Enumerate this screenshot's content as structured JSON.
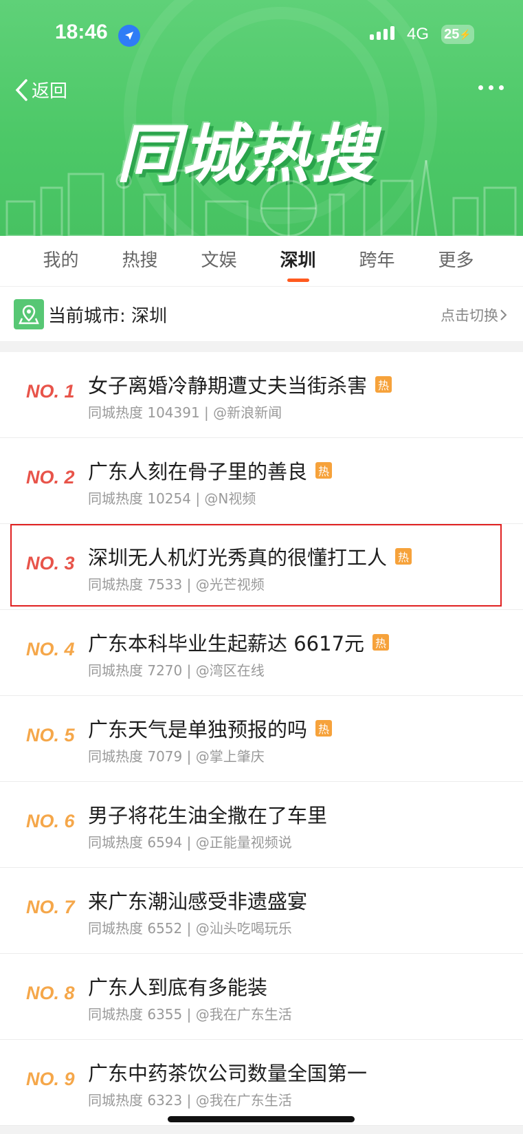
{
  "status_bar": {
    "time": "18:46",
    "network": "4G",
    "battery": "25"
  },
  "header": {
    "back_label": "返回",
    "banner_title": "同城热搜"
  },
  "tabs": [
    {
      "label": "我的"
    },
    {
      "label": "热搜"
    },
    {
      "label": "文娱"
    },
    {
      "label": "深圳",
      "active": true
    },
    {
      "label": "跨年"
    },
    {
      "label": "更多"
    }
  ],
  "city": {
    "label": "当前城市: 深圳",
    "switch_label": "点击切换"
  },
  "hot_badge": "热",
  "items": [
    {
      "rank": "NO. 1",
      "title": "女子离婚冷静期遭丈夫当街杀害",
      "hot": true,
      "meta": "同城热度 104391 | @新浪新闻"
    },
    {
      "rank": "NO. 2",
      "title": "广东人刻在骨子里的善良",
      "hot": true,
      "meta": "同城热度 10254 | @N视频"
    },
    {
      "rank": "NO. 3",
      "title": "深圳无人机灯光秀真的很懂打工人",
      "hot": true,
      "meta": "同城热度 7533 | @光芒视频"
    },
    {
      "rank": "NO. 4",
      "title": "广东本科毕业生起薪达 6617元",
      "hot": true,
      "meta": "同城热度 7270 | @湾区在线"
    },
    {
      "rank": "NO. 5",
      "title": "广东天气是单独预报的吗",
      "hot": true,
      "meta": "同城热度 7079 | @掌上肇庆"
    },
    {
      "rank": "NO. 6",
      "title": "男子将花生油全撒在了车里",
      "hot": false,
      "meta": "同城热度 6594 | @正能量视频说"
    },
    {
      "rank": "NO. 7",
      "title": "来广东潮汕感受非遗盛宴",
      "hot": false,
      "meta": "同城热度 6552 | @汕头吃喝玩乐"
    },
    {
      "rank": "NO. 8",
      "title": "广东人到底有多能装",
      "hot": false,
      "meta": "同城热度 6355 | @我在广东生活"
    },
    {
      "rank": "NO. 9",
      "title": "广东中药茶饮公司数量全国第一",
      "hot": false,
      "meta": "同城热度 6323 | @我在广东生活"
    }
  ]
}
